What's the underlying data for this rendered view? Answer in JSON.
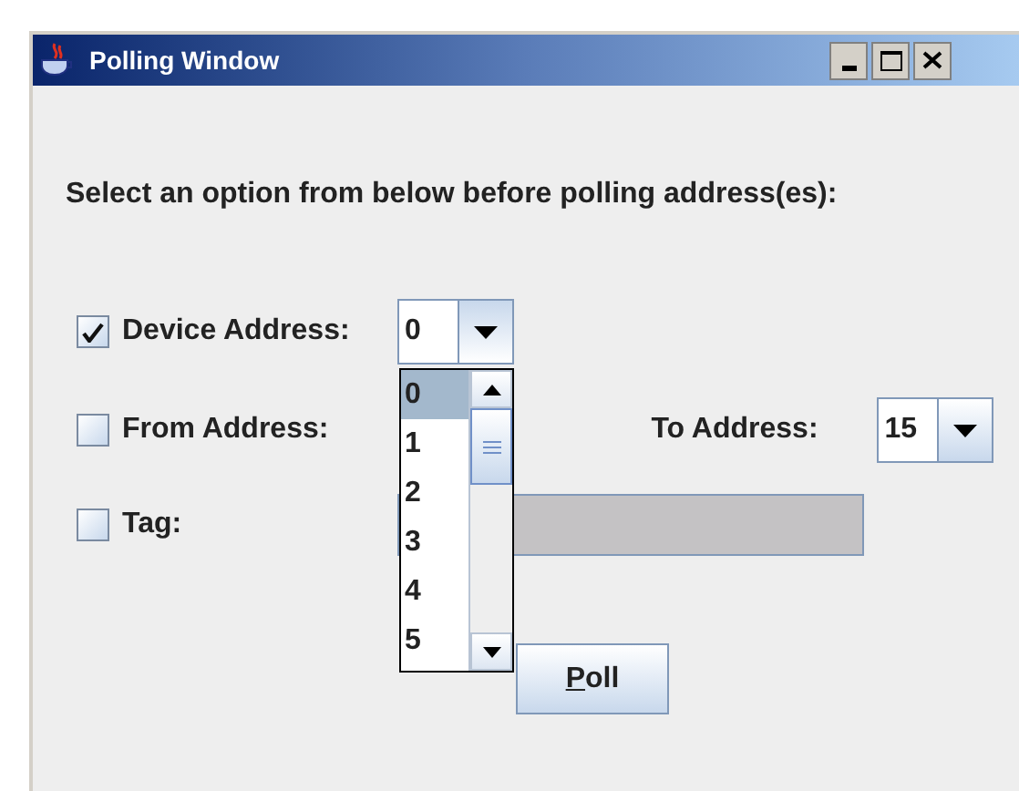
{
  "window": {
    "title": "Polling Window"
  },
  "instruction": "Select an option from below before polling address(es):",
  "device_address": {
    "label": "Device Address:",
    "checked": true,
    "value": "0",
    "expanded": true
  },
  "from_address": {
    "label": "From Address:",
    "checked": false
  },
  "to_address": {
    "label": "To Address:",
    "value": "15"
  },
  "tag": {
    "label": "Tag:",
    "checked": false,
    "field_disabled": true
  },
  "dropdown_options": [
    {
      "label": "0",
      "selected": true
    },
    {
      "label": "1",
      "selected": false
    },
    {
      "label": "2",
      "selected": false
    },
    {
      "label": "3",
      "selected": false
    },
    {
      "label": "4",
      "selected": false
    },
    {
      "label": "5",
      "selected": false
    }
  ],
  "poll_button": {
    "label": "Poll"
  }
}
